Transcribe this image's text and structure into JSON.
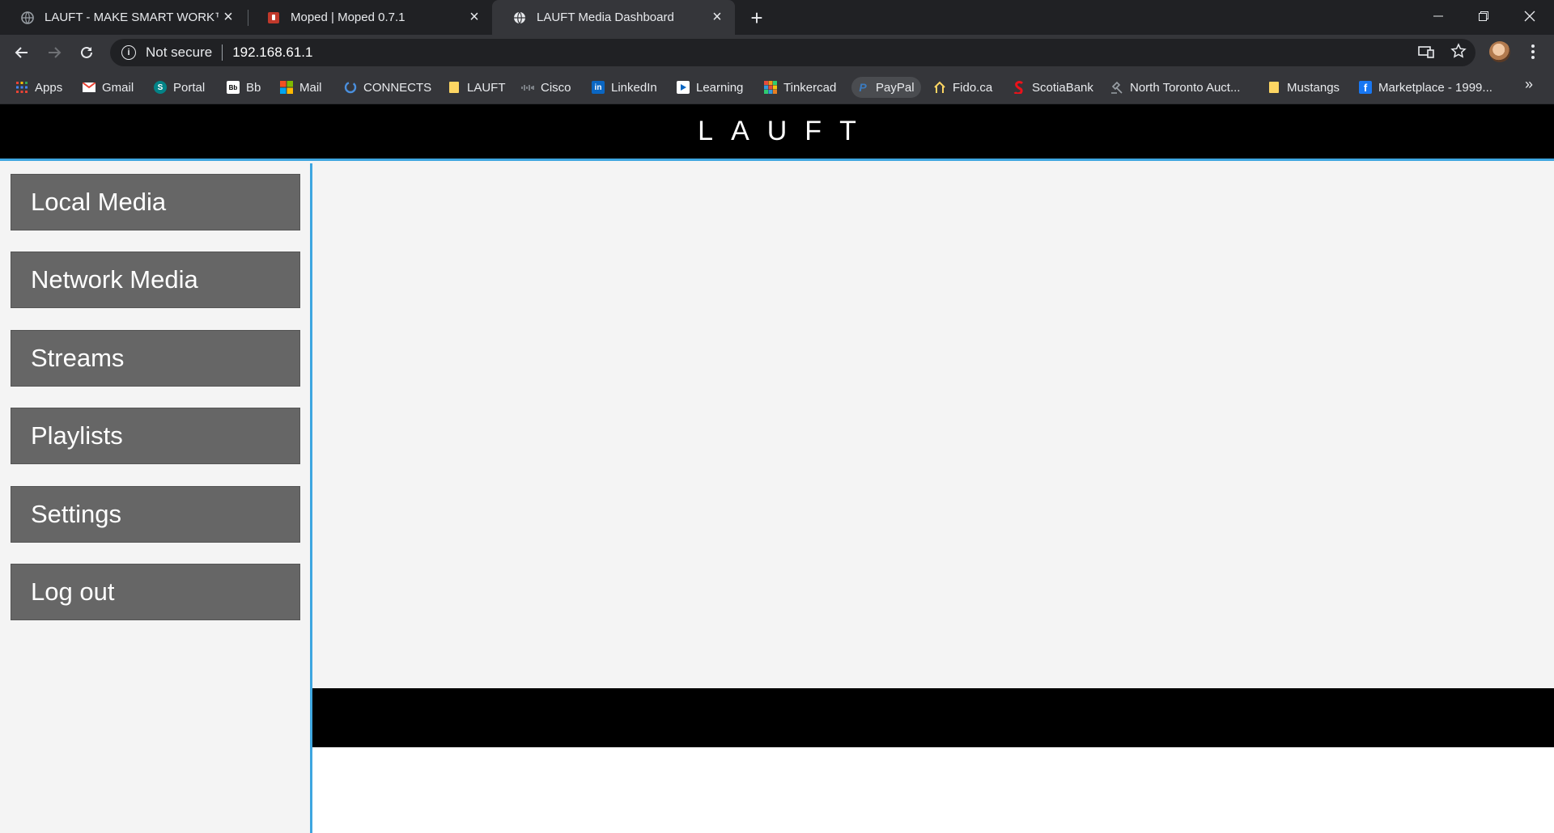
{
  "browser": {
    "tabs": [
      {
        "title": "LAUFT - MAKE SMART WORK™",
        "icon": "globe-icon",
        "active": false
      },
      {
        "title": "Moped | Moped 0.7.1",
        "icon": "moped-icon",
        "active": false
      },
      {
        "title": "LAUFT Media Dashboard",
        "icon": "globe-icon",
        "active": true
      }
    ],
    "address": {
      "security_label": "Not secure",
      "url": "192.168.61.1"
    },
    "bookmarks": [
      {
        "label": "Apps",
        "icon": "apps-grid-icon"
      },
      {
        "label": "Gmail",
        "icon": "gmail-icon"
      },
      {
        "label": "Portal",
        "icon": "sharepoint-icon"
      },
      {
        "label": "Bb",
        "icon": "blackboard-icon"
      },
      {
        "label": "Mail",
        "icon": "microsoft-icon"
      },
      {
        "label": "CONNECTS",
        "icon": "connects-icon"
      },
      {
        "label": "LAUFT",
        "icon": "folder-icon"
      },
      {
        "label": "Cisco",
        "icon": "cisco-icon"
      },
      {
        "label": "LinkedIn",
        "icon": "linkedin-icon"
      },
      {
        "label": "Learning",
        "icon": "learning-icon"
      },
      {
        "label": "Tinkercad",
        "icon": "tinkercad-icon"
      },
      {
        "label": "PayPal",
        "icon": "paypal-icon"
      },
      {
        "label": "Fido.ca",
        "icon": "fido-icon"
      },
      {
        "label": "ScotiaBank",
        "icon": "scotiabank-icon"
      },
      {
        "label": "North Toronto Auct...",
        "icon": "auction-icon"
      },
      {
        "label": "Mustangs",
        "icon": "folder-icon"
      },
      {
        "label": "Marketplace - 1999...",
        "icon": "facebook-icon"
      }
    ]
  },
  "header": {
    "logo_text": "LAUFT"
  },
  "sidebar": {
    "items": [
      {
        "label": "Local Media"
      },
      {
        "label": "Network Media"
      },
      {
        "label": "Streams"
      },
      {
        "label": "Playlists"
      },
      {
        "label": "Settings"
      },
      {
        "label": "Log out"
      }
    ]
  },
  "colors": {
    "accent": "#3ea6e0",
    "header_bg": "#000000",
    "button_bg": "#666666",
    "page_bg": "#f4f4f4"
  }
}
